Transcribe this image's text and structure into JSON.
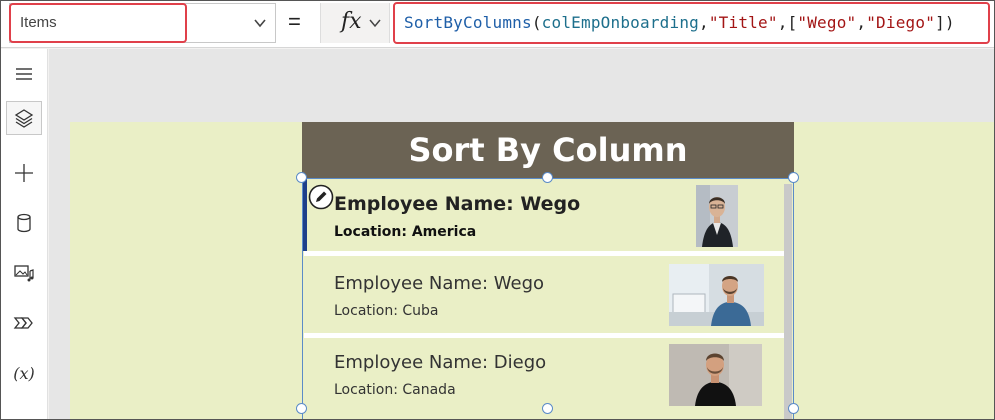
{
  "formula_bar": {
    "property": "Items",
    "equals": "=",
    "fx_label": "fx",
    "formula": {
      "func": "SortByColumns",
      "open": "(",
      "collection": "colEmpOnboarding",
      "comma1": ",",
      "column": "\"Title\"",
      "comma2": ",",
      "bracket_open": "[",
      "val1": "\"Wego\"",
      "comma3": ",",
      "val2": "\"Diego\"",
      "bracket_close": "]",
      "close": ")"
    }
  },
  "left_rail": {
    "items": [
      "menu-icon",
      "layers-icon",
      "insert-icon",
      "data-icon",
      "media-icon",
      "power-automate-icon",
      "variables-icon"
    ],
    "variables_label": "(x)"
  },
  "app": {
    "title": "Sort By Column",
    "gallery": [
      {
        "name": "Employee Name: Wego",
        "location": "Location: America",
        "selected": true
      },
      {
        "name": "Employee Name: Wego",
        "location": "Location: Cuba",
        "selected": false
      },
      {
        "name": "Employee Name: Diego",
        "location": "Location: Canada",
        "selected": false
      }
    ]
  },
  "colors": {
    "accent_red": "#e0404a",
    "title_bg": "#6b6354",
    "screen_bg": "#eaefc6",
    "selection": "#5b8bc8"
  }
}
